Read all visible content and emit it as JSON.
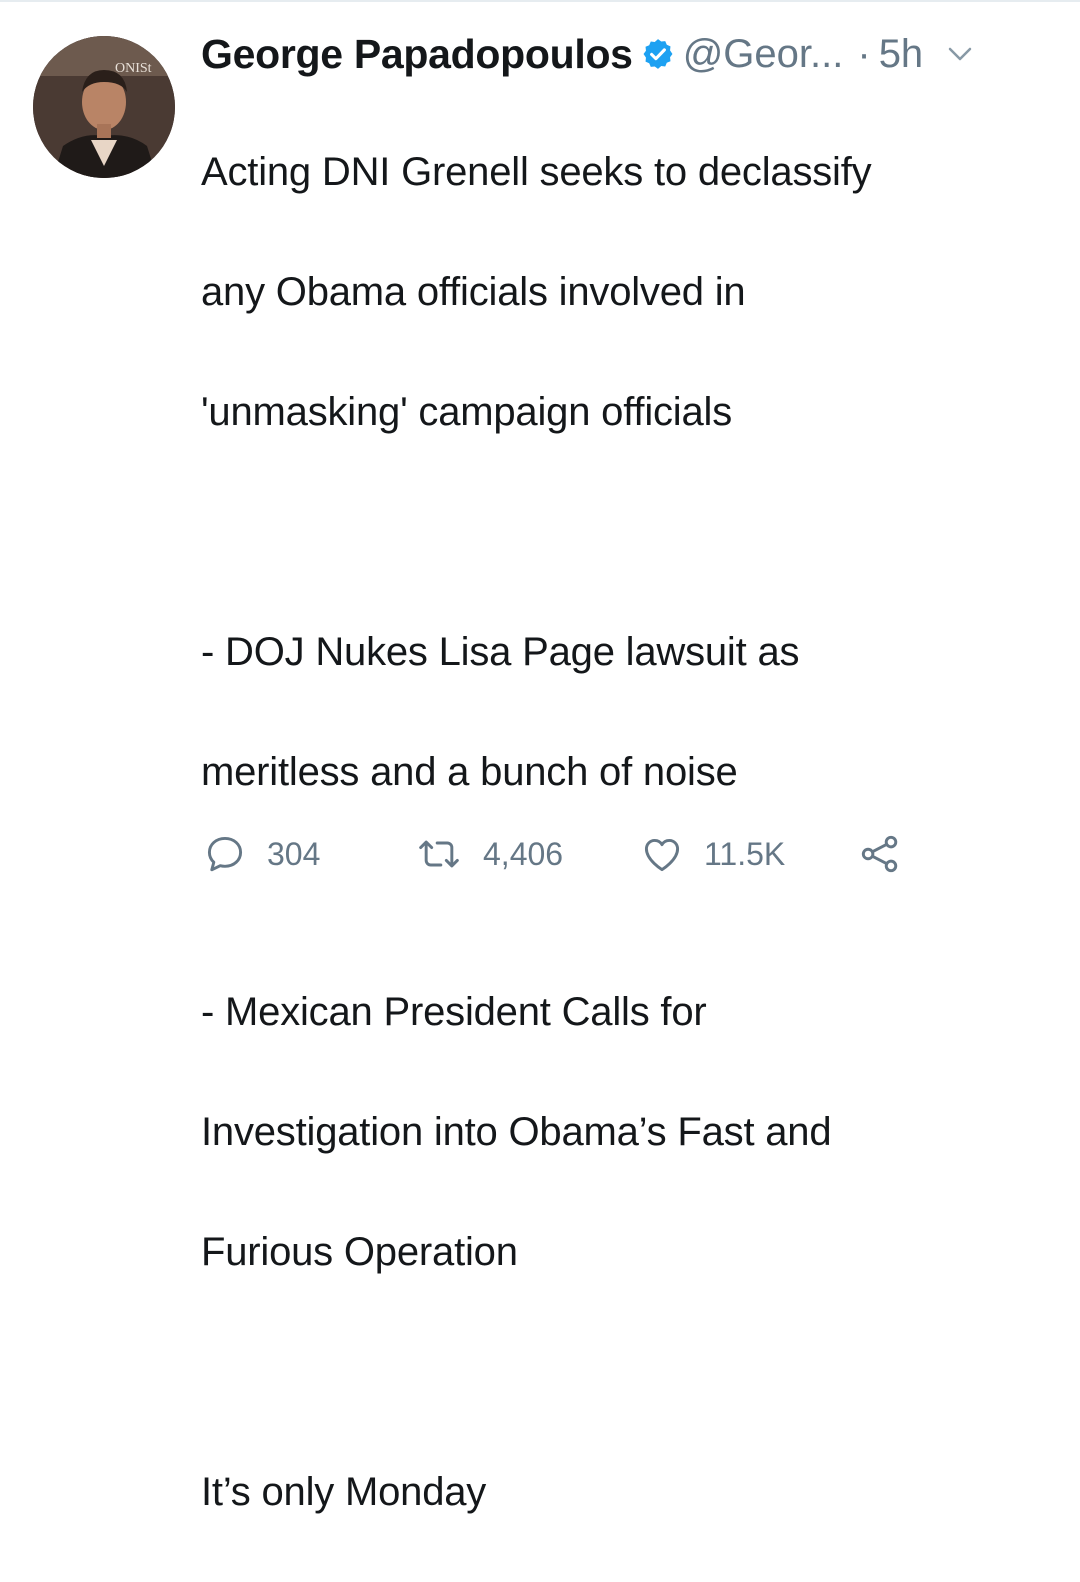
{
  "tweet": {
    "author_name": "George Papadopoulos",
    "handle": "@Geor...",
    "separator": "·",
    "time": "5h",
    "verified": true,
    "lines": [
      "Acting DNI Grenell seeks to declassify",
      "any Obama officials involved in",
      "'unmasking' campaign officials",
      "",
      "- DOJ Nukes Lisa Page lawsuit as",
      "meritless and a bunch of noise",
      "",
      "- Mexican President Calls for",
      "Investigation into Obama’s Fast and",
      "Furious Operation",
      "",
      "It’s only Monday"
    ]
  },
  "actions": {
    "replies": "304",
    "retweets": "4,406",
    "likes": "11.5K"
  },
  "icons": {
    "verified": "verified-badge-icon",
    "caret": "chevron-down-icon",
    "reply": "reply-icon",
    "retweet": "retweet-icon",
    "like": "heart-icon",
    "share": "share-icon"
  },
  "colors": {
    "text": "#14171a",
    "muted": "#657786",
    "verified_blue": "#1da1f2"
  }
}
